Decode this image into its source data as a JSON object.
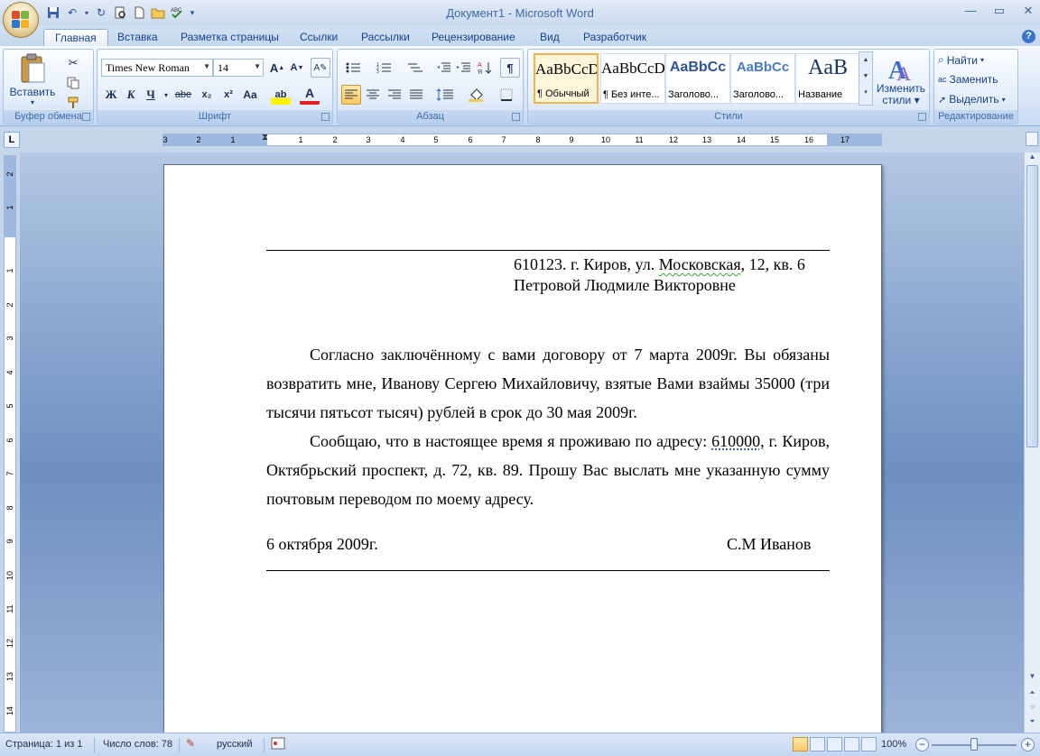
{
  "window": {
    "title": "Документ1 - Microsoft Word",
    "controls": [
      "minimize",
      "maximize",
      "close"
    ]
  },
  "quick_access": [
    "save-icon",
    "undo-icon",
    "redo-icon",
    "print-preview-icon",
    "new-doc-icon",
    "open-icon",
    "spelling-icon"
  ],
  "tabs": [
    {
      "label": "Главная",
      "active": true
    },
    {
      "label": "Вставка"
    },
    {
      "label": "Разметка страницы"
    },
    {
      "label": "Ссылки"
    },
    {
      "label": "Рассылки"
    },
    {
      "label": "Рецензирование"
    },
    {
      "label": "Вид"
    },
    {
      "label": "Разработчик"
    }
  ],
  "ribbon": {
    "clipboard": {
      "label": "Буфер обмена",
      "paste_label": "Вставить"
    },
    "font": {
      "label": "Шрифт",
      "font_name": "Times New Roman",
      "font_size": "14",
      "buttons": {
        "bold": "Ж",
        "italic": "К",
        "underline": "Ч",
        "strike": "abe",
        "sub": "x₂",
        "sup": "x²",
        "case": "Aa",
        "grow": "A",
        "shrink": "A",
        "font_color": "A",
        "highlight": "ab"
      }
    },
    "paragraph": {
      "label": "Абзац",
      "pilcrow": "¶"
    },
    "styles": {
      "label": "Стили",
      "items": [
        {
          "sample": "AaBbCcDd",
          "name": "¶ Обычный",
          "selected": true
        },
        {
          "sample": "AaBbCcDd",
          "name": "¶ Без инте..."
        },
        {
          "sample": "AaBbCc",
          "name": "Заголово..."
        },
        {
          "sample": "AaBbCc",
          "name": "Заголово..."
        },
        {
          "sample": "AaB",
          "name": "Название"
        }
      ],
      "change_styles_line1": "Изменить",
      "change_styles_line2": "стили"
    },
    "editing": {
      "label": "Редактирование",
      "find": "Найти",
      "replace": "Заменить",
      "select": "Выделить"
    }
  },
  "ruler": {
    "h_labels": [
      "3",
      "2",
      "1",
      "1",
      "2",
      "3",
      "4",
      "5",
      "6",
      "7",
      "8",
      "9",
      "10",
      "11",
      "12",
      "13",
      "14",
      "15",
      "16",
      "17"
    ],
    "v_labels": [
      "2",
      "1",
      "1",
      "2",
      "3",
      "4",
      "5",
      "6",
      "7",
      "8",
      "9",
      "10",
      "11",
      "12",
      "13",
      "14"
    ]
  },
  "document": {
    "address_line1_pre": "610123. г. Киров, ул. ",
    "address_line1_squig": "Московская",
    "address_line1_post": ", 12, кв. 6",
    "address_line2": "Петровой Людмиле Викторовне",
    "para1": "Согласно заключённому с вами договору от 7 марта 2009г. Вы обязаны возвратить мне, Иванову Сергею Михайловичу, взятые Вами взаймы 35000 (три тысячи пятьсот тысяч) рублей в срок до 30 мая 2009г.",
    "para2_pre": "Сообщаю, что в настоящее время я проживаю по адресу: ",
    "para2_squig": "610000,",
    "para2_post": " г. Киров, Октябрьский проспект, д. 72, кв. 89. Прошу Вас выслать мне указанную сумму почтовым переводом по моему адресу.",
    "date": "6 октября 2009г.",
    "signature": "С.М Иванов"
  },
  "statusbar": {
    "page": "Страница: 1 из 1",
    "words": "Число слов: 78",
    "language": "русский",
    "zoom": "100%",
    "zoom_out": "−",
    "zoom_in": "+"
  }
}
